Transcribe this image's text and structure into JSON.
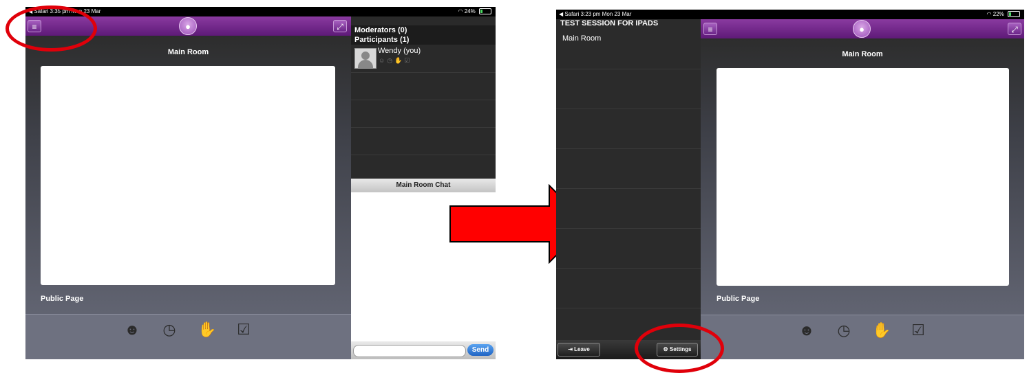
{
  "left": {
    "status": {
      "app": "Safari",
      "time": "3:35 pm",
      "date": "Mon 23 Mar",
      "wifi": "⌔",
      "battery": "24%"
    },
    "room_title": "Main Room",
    "public_page": "Public Page",
    "participants": {
      "moderators": "Moderators (0)",
      "participants": "Participants (1)",
      "user": "Wendy (you)"
    },
    "chat_title": "Main Room Chat",
    "send_label": "Send",
    "chat_placeholder": ""
  },
  "right": {
    "status": {
      "app": "Safari",
      "time": "3:23 pm",
      "date": "Mon 23 Mar",
      "battery": "22%"
    },
    "session_title": "TEST SESSION FOR IPADS",
    "room_item": "Main Room",
    "room_title": "Main Room",
    "public_page": "Public Page",
    "leave_label": "Leave",
    "settings_label": "Settings"
  },
  "icons": {
    "menu": "≡",
    "expand": "⤢",
    "mic": "🎙",
    "emoji": "☻",
    "clock": "◷",
    "hand": "✋",
    "check": "☑",
    "gear": "⚙",
    "door": "⇥"
  },
  "colors": {
    "purple": "#7a2d93",
    "highlight": "#e0000a",
    "arrow": "#ff0000",
    "send": "#2f7fd9"
  },
  "battery_level": {
    "left": 0.24,
    "right": 0.22
  }
}
